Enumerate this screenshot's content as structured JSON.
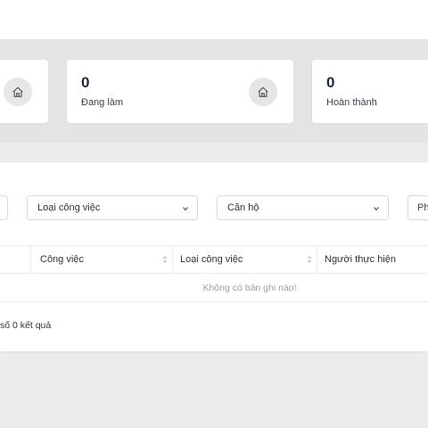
{
  "stats": [
    {
      "count": "0",
      "label": "Đang làm",
      "icon": "home-icon"
    },
    {
      "count": "0",
      "label": "Hoàn thành",
      "icon": "home-icon"
    }
  ],
  "filters": {
    "job_type": "Loại công việc",
    "apartment": "Căn hộ",
    "partial_button": "Ph"
  },
  "table": {
    "columns": [
      "Công việc",
      "Loại công việc",
      "Người thực hiện"
    ],
    "empty_text": "Không có bản ghi nào!",
    "result_text": "số 0 kết quả"
  }
}
